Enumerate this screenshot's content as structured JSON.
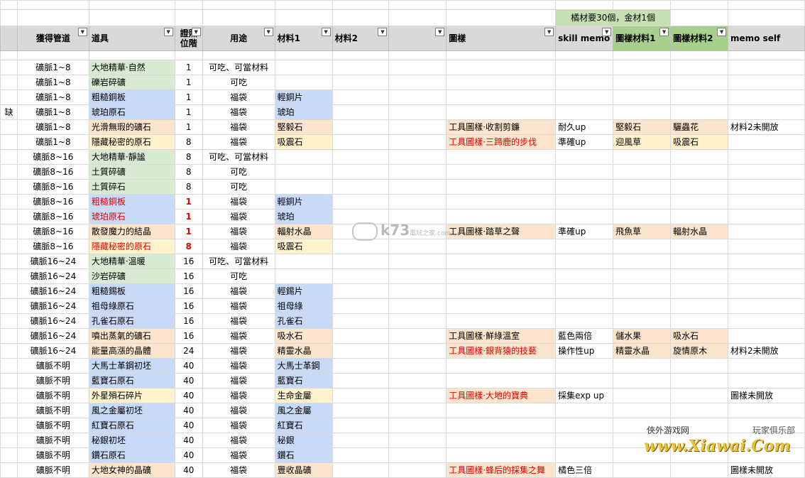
{
  "top_note": "橘材要30個，金材1個",
  "headers": {
    "h1": "獲得管道",
    "h2": "道具",
    "h3": "證照\n位階",
    "h4": "用途",
    "h5": "材料1",
    "h6": "材料2",
    "h7": "",
    "h8": "圖樣",
    "h9": "skill memo",
    "h10": "圖樣材料1",
    "h11": "圖樣材料2",
    "h12": "memo self"
  },
  "rows": [
    {
      "left": "",
      "src": "礦脈1~8",
      "item": "大地精華·自然",
      "lv": "1",
      "use": "可吃、可當材料",
      "m1": "",
      "m2": "",
      "p": "",
      "pat": "",
      "sk": "",
      "pm1": "",
      "pm2": "",
      "memo": ""
    },
    {
      "left": "",
      "src": "礦脈1~8",
      "item": "礫岩碎礦",
      "lv": "1",
      "use": "可吃",
      "m1": "",
      "m2": "",
      "p": "",
      "pat": "",
      "sk": "",
      "pm1": "",
      "pm2": "",
      "memo": ""
    },
    {
      "left": "",
      "src": "礦脈1~8",
      "item": "粗糙銅板",
      "lv": "1",
      "use": "福袋",
      "m1": "輕銅片",
      "m2": "",
      "p": "",
      "pat": "",
      "sk": "",
      "pm1": "",
      "pm2": "",
      "memo": ""
    },
    {
      "left": "缺",
      "src": "礦脈1~8",
      "item": "琥珀原石",
      "lv": "1",
      "use": "福袋",
      "m1": "琥珀",
      "m2": "",
      "p": "",
      "pat": "",
      "sk": "",
      "pm1": "",
      "pm2": "",
      "memo": ""
    },
    {
      "left": "",
      "src": "礦脈1~8",
      "item": "光滑無瑕的礦石",
      "lv": "1",
      "use": "福袋",
      "m1": "堅毅石",
      "m2": "",
      "p": "",
      "pat": "工具圖樣·收割剪鐮",
      "sk": "耐久up",
      "pm1": "堅毅石",
      "pm2": "驪蟲花",
      "memo": "材料2未開放"
    },
    {
      "left": "",
      "src": "礦脈1~8",
      "item": "隱藏秘密的原石",
      "lv": "8",
      "use": "福袋",
      "m1": "吸震石",
      "m2": "",
      "p": "",
      "pat": "工具圖樣·三蹄鹿的步伐",
      "sk": "準確up",
      "pm1": "迎風草",
      "pm2": "吸震石",
      "memo": ""
    },
    {
      "left": "",
      "src": "礦脈8~16",
      "item": "大地精華·靜謐",
      "lv": "8",
      "use": "可吃、可當材料",
      "m1": "",
      "m2": "",
      "p": "",
      "pat": "",
      "sk": "",
      "pm1": "",
      "pm2": "",
      "memo": ""
    },
    {
      "left": "",
      "src": "礦脈8~16",
      "item": "土質碎礦",
      "lv": "8",
      "use": "可吃",
      "m1": "",
      "m2": "",
      "p": "",
      "pat": "",
      "sk": "",
      "pm1": "",
      "pm2": "",
      "memo": ""
    },
    {
      "left": "",
      "src": "礦脈8~16",
      "item": "土質碎石",
      "lv": "8",
      "use": "可吃",
      "m1": "",
      "m2": "",
      "p": "",
      "pat": "",
      "sk": "",
      "pm1": "",
      "pm2": "",
      "memo": ""
    },
    {
      "left": "",
      "src": "礦脈8~16",
      "item": "粗糙銅板",
      "lv": "1",
      "use": "福袋",
      "m1": "輕銅片",
      "m2": "",
      "p": "",
      "pat": "",
      "sk": "",
      "pm1": "",
      "pm2": "",
      "memo": ""
    },
    {
      "left": "",
      "src": "礦脈8~16",
      "item": "琥珀原石",
      "lv": "1",
      "use": "福袋",
      "m1": "琥珀",
      "m2": "",
      "p": "",
      "pat": "",
      "sk": "",
      "pm1": "",
      "pm2": "",
      "memo": ""
    },
    {
      "left": "",
      "src": "礦脈8~16",
      "item": "散發魔力的結晶",
      "lv": "1",
      "use": "福袋",
      "m1": "輻射水晶",
      "m2": "",
      "p": "",
      "pat": "工具圖樣·踏草之聲",
      "sk": "準確up",
      "pm1": "飛魚草",
      "pm2": "輻射水晶",
      "memo": ""
    },
    {
      "left": "",
      "src": "礦脈8~16",
      "item": "隱藏秘密的原石",
      "lv": "8",
      "use": "福袋",
      "m1": "吸震石",
      "m2": "",
      "p": "",
      "pat": "",
      "sk": "",
      "pm1": "",
      "pm2": "",
      "memo": ""
    },
    {
      "left": "",
      "src": "礦脈16~24",
      "item": "大地精華·溫暖",
      "lv": "16",
      "use": "可吃、可當材料",
      "m1": "",
      "m2": "",
      "p": "",
      "pat": "",
      "sk": "",
      "pm1": "",
      "pm2": "",
      "memo": ""
    },
    {
      "left": "",
      "src": "礦脈16~24",
      "item": "沙岩碎礦",
      "lv": "16",
      "use": "可吃",
      "m1": "",
      "m2": "",
      "p": "",
      "pat": "",
      "sk": "",
      "pm1": "",
      "pm2": "",
      "memo": ""
    },
    {
      "left": "",
      "src": "礦脈16~24",
      "item": "粗糙錫板",
      "lv": "16",
      "use": "福袋",
      "m1": "輕錫片",
      "m2": "",
      "p": "",
      "pat": "",
      "sk": "",
      "pm1": "",
      "pm2": "",
      "memo": ""
    },
    {
      "left": "",
      "src": "礦脈16~24",
      "item": "祖母綠原石",
      "lv": "16",
      "use": "福袋",
      "m1": "祖母綠",
      "m2": "",
      "p": "",
      "pat": "",
      "sk": "",
      "pm1": "",
      "pm2": "",
      "memo": ""
    },
    {
      "left": "",
      "src": "礦脈16~24",
      "item": "孔雀石原石",
      "lv": "16",
      "use": "福袋",
      "m1": "孔雀石",
      "m2": "",
      "p": "",
      "pat": "",
      "sk": "",
      "pm1": "",
      "pm2": "",
      "memo": ""
    },
    {
      "left": "",
      "src": "礦脈16~24",
      "item": "噴出蒸氣的礦石",
      "lv": "16",
      "use": "福袋",
      "m1": "吸水石",
      "m2": "",
      "p": "",
      "pat": "工具圖樣·鮮綠溫室",
      "sk": "藍色兩倍",
      "pm1": "儲水果",
      "pm2": "吸水石",
      "memo": ""
    },
    {
      "left": "",
      "src": "礦脈16~24",
      "item": "能量高漲的晶體",
      "lv": "24",
      "use": "福袋",
      "m1": "精靈水晶",
      "m2": "",
      "p": "",
      "pat": "工具圖樣·銀背猿的技藝",
      "sk": "操作性up",
      "pm1": "精靈水晶",
      "pm2": "旋情原木",
      "memo": "材料2未開放"
    },
    {
      "left": "",
      "src": "礦脈不明",
      "item": "大馬士革鋼初坯",
      "lv": "40",
      "use": "福袋",
      "m1": "大馬士革鋼",
      "m2": "",
      "p": "",
      "pat": "",
      "sk": "",
      "pm1": "",
      "pm2": "",
      "memo": ""
    },
    {
      "left": "",
      "src": "礦脈不明",
      "item": "藍寶石原石",
      "lv": "40",
      "use": "福袋",
      "m1": "藍寶石",
      "m2": "",
      "p": "",
      "pat": "",
      "sk": "",
      "pm1": "",
      "pm2": "",
      "memo": ""
    },
    {
      "left": "",
      "src": "礦脈不明",
      "item": "外星殞石碎片",
      "lv": "40",
      "use": "福袋",
      "m1": "生命金屬",
      "m2": "",
      "p": "",
      "pat": "工具圖樣·大地的寶典",
      "sk": "採集exp up",
      "pm1": "",
      "pm2": "",
      "memo": "圖樣未開放"
    },
    {
      "left": "",
      "src": "礦脈不明",
      "item": "風之金屬初坯",
      "lv": "40",
      "use": "福袋",
      "m1": "風之金屬",
      "m2": "",
      "p": "",
      "pat": "",
      "sk": "",
      "pm1": "",
      "pm2": "",
      "memo": ""
    },
    {
      "left": "",
      "src": "礦脈不明",
      "item": "紅寶石原石",
      "lv": "40",
      "use": "福袋",
      "m1": "紅寶石",
      "m2": "",
      "p": "",
      "pat": "",
      "sk": "",
      "pm1": "",
      "pm2": "",
      "memo": ""
    },
    {
      "left": "",
      "src": "礦脈不明",
      "item": "秘銀初坯",
      "lv": "40",
      "use": "福袋",
      "m1": "秘銀",
      "m2": "",
      "p": "",
      "pat": "",
      "sk": "",
      "pm1": "",
      "pm2": "",
      "memo": ""
    },
    {
      "left": "",
      "src": "礦脈不明",
      "item": "鑽石原石",
      "lv": "40",
      "use": "福袋",
      "m1": "鑽石",
      "m2": "",
      "p": "",
      "pat": "",
      "sk": "",
      "pm1": "",
      "pm2": "",
      "memo": ""
    },
    {
      "left": "",
      "src": "礦脈不明",
      "item": "大地女神的晶礦",
      "lv": "40",
      "use": "福袋",
      "m1": "豐收晶礦",
      "m2": "",
      "p": "",
      "pat": "工具圖樣·蜂后的採集之舞",
      "sk": "橘色三倍",
      "pm1": "",
      "pm2": "",
      "memo": "圖樣未開放"
    }
  ],
  "watermark_center": {
    "text": "k73",
    "sub": "電玩之家",
    "sub2": ".com"
  },
  "watermark_corner": {
    "line1": "俠外游戏网",
    "line2": "玩家俱乐部",
    "url": "www.Xiawai.Com"
  }
}
